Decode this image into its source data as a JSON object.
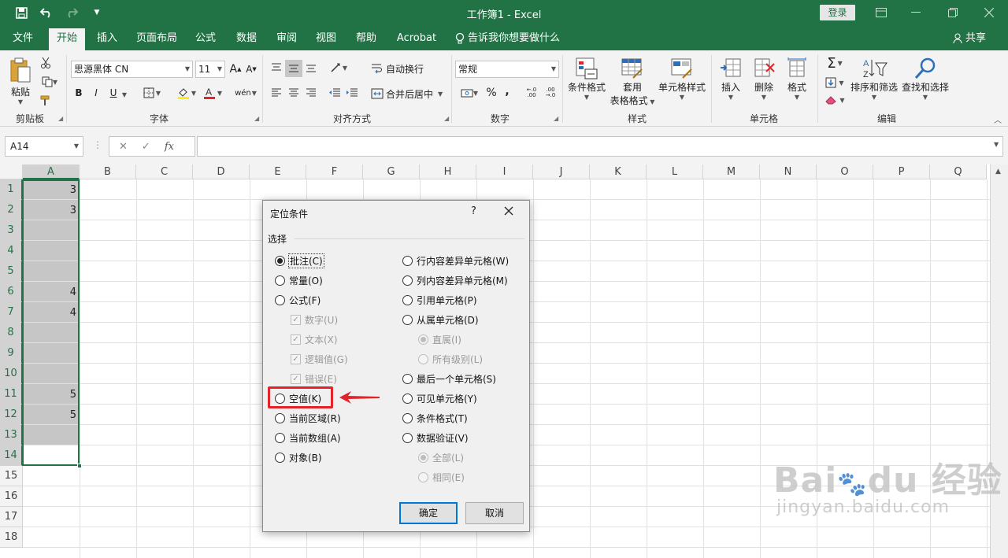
{
  "window": {
    "title": "工作簿1  -  Excel",
    "login_label": "登录",
    "controls": [
      "ribbon-display-icon",
      "minimize-icon",
      "restore-icon",
      "close-icon"
    ]
  },
  "quick_access": [
    "save-icon",
    "undo-icon",
    "redo-icon",
    "customize-icon"
  ],
  "tabs": [
    {
      "label": "文件"
    },
    {
      "label": "开始",
      "active": true
    },
    {
      "label": "插入"
    },
    {
      "label": "页面布局"
    },
    {
      "label": "公式"
    },
    {
      "label": "数据"
    },
    {
      "label": "审阅"
    },
    {
      "label": "视图"
    },
    {
      "label": "帮助"
    },
    {
      "label": "Acrobat"
    }
  ],
  "tell_me": "告诉我你想要做什么",
  "share": "共享",
  "ribbon": {
    "clipboard": {
      "paste": "粘贴",
      "label": "剪贴板"
    },
    "font": {
      "name": "思源黑体 CN",
      "size": "11",
      "label": "字体",
      "bold": "B",
      "italic": "I",
      "underline": "U",
      "grow": "A",
      "shrink": "A"
    },
    "alignment": {
      "wrap": "自动换行",
      "merge": "合并后居中",
      "label": "对齐方式"
    },
    "number": {
      "format": "常规",
      "label": "数字",
      "percent": "%",
      "comma": ","
    },
    "styles": {
      "conditional": "条件格式",
      "table_line1": "套用",
      "table_line2": "表格格式",
      "cell_styles": "单元格样式",
      "label": "样式"
    },
    "cells": {
      "insert": "插入",
      "delete": "删除",
      "format": "格式",
      "label": "单元格"
    },
    "editing": {
      "sort": "排序和筛选",
      "find": "查找和选择",
      "label": "编辑",
      "sum": "Σ"
    }
  },
  "formula_bar": {
    "name_box": "A14",
    "fx": "fx",
    "value": ""
  },
  "sheet": {
    "columns": [
      "A",
      "B",
      "C",
      "D",
      "E",
      "F",
      "G",
      "H",
      "I",
      "J",
      "K",
      "L",
      "M",
      "N",
      "O",
      "P",
      "Q"
    ],
    "rows": [
      "1",
      "2",
      "3",
      "4",
      "5",
      "6",
      "7",
      "8",
      "9",
      "10",
      "11",
      "12",
      "13",
      "14",
      "15",
      "16",
      "17",
      "18"
    ],
    "col_a_values": [
      "3",
      "3",
      "",
      "",
      "",
      "4",
      "4",
      "",
      "",
      "",
      "5",
      "5",
      "",
      ""
    ],
    "selected_column": "A",
    "active_cell": "A14"
  },
  "dialog": {
    "title": "定位条件",
    "help": "?",
    "section": "选择",
    "left_options": [
      {
        "label": "批注(C)",
        "selected": true,
        "type": "radio"
      },
      {
        "label": "常量(O)",
        "type": "radio"
      },
      {
        "label": "公式(F)",
        "type": "radio"
      },
      {
        "label": "数字(U)",
        "type": "check",
        "disabled": true,
        "checked": true
      },
      {
        "label": "文本(X)",
        "type": "check",
        "disabled": true,
        "checked": true
      },
      {
        "label": "逻辑值(G)",
        "type": "check",
        "disabled": true,
        "checked": true
      },
      {
        "label": "错误(E)",
        "type": "check",
        "disabled": true,
        "checked": true
      },
      {
        "label": "空值(K)",
        "type": "radio",
        "highlighted": true
      },
      {
        "label": "当前区域(R)",
        "type": "radio"
      },
      {
        "label": "当前数组(A)",
        "type": "radio"
      },
      {
        "label": "对象(B)",
        "type": "radio"
      }
    ],
    "right_options": [
      {
        "label": "行内容差异单元格(W)",
        "type": "radio"
      },
      {
        "label": "列内容差异单元格(M)",
        "type": "radio"
      },
      {
        "label": "引用单元格(P)",
        "type": "radio"
      },
      {
        "label": "从属单元格(D)",
        "type": "radio"
      },
      {
        "label": "直属(I)",
        "type": "radio",
        "disabled": true,
        "selected": true
      },
      {
        "label": "所有级别(L)",
        "type": "radio",
        "disabled": true
      },
      {
        "label": "最后一个单元格(S)",
        "type": "radio"
      },
      {
        "label": "可见单元格(Y)",
        "type": "radio"
      },
      {
        "label": "条件格式(T)",
        "type": "radio"
      },
      {
        "label": "数据验证(V)",
        "type": "radio"
      },
      {
        "label": "全部(L)",
        "type": "radio",
        "disabled": true,
        "selected": true
      },
      {
        "label": "相同(E)",
        "type": "radio",
        "disabled": true
      }
    ],
    "ok": "确定",
    "cancel": "取消"
  },
  "annotation": {
    "color": "#e0242a"
  },
  "watermark": {
    "logo": "Bai du 经验",
    "url": "jingyan.baidu.com"
  },
  "colors": {
    "excel_green": "#217346",
    "selection_fill": "#c6c6c6",
    "dialog_bg": "#f0f0f0"
  }
}
